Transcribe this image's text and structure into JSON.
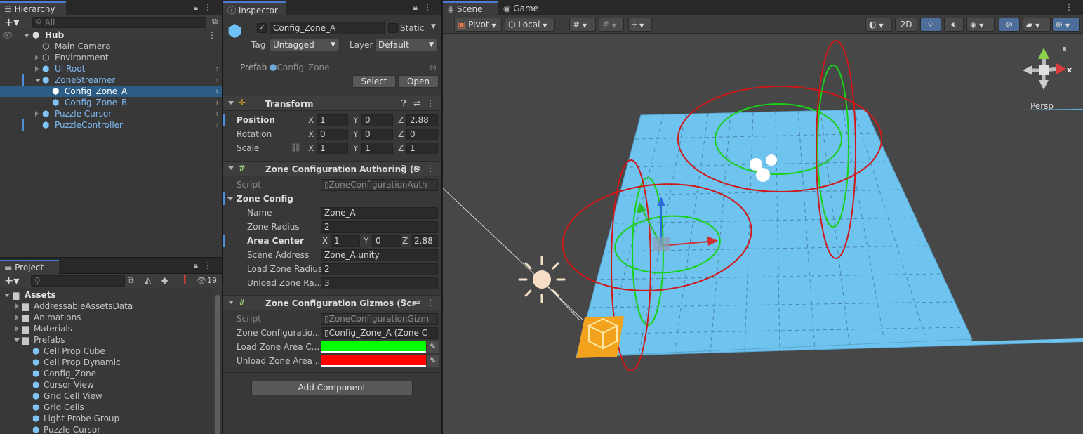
{
  "hierarchy": {
    "tab": "Hierarchy",
    "search_placeholder": "All",
    "root": "Hub",
    "items": [
      {
        "label": "Main Camera"
      },
      {
        "label": "Environment"
      },
      {
        "label": "UI Root"
      },
      {
        "label": "ZoneStreamer"
      },
      {
        "label": "Config_Zone_A"
      },
      {
        "label": "Config_Zone_B"
      },
      {
        "label": "Puzzle Cursor"
      },
      {
        "label": "PuzzleController"
      }
    ]
  },
  "project": {
    "tab": "Project",
    "hidden_count": "19",
    "root": "Assets",
    "folders": [
      "AddressableAssetsData",
      "Animations",
      "Materials",
      "Prefabs"
    ],
    "prefabs": [
      "Cell Prop Cube",
      "Cell Prop Dynamic",
      "Config_Zone",
      "Cursor View",
      "Grid Cell View",
      "Grid Cells",
      "Light Probe Group",
      "Puzzle Cursor"
    ]
  },
  "inspector": {
    "tab": "Inspector",
    "object_name": "Config_Zone_A",
    "static_label": "Static",
    "tag_label": "Tag",
    "tag_value": "Untagged",
    "layer_label": "Layer",
    "layer_value": "Default",
    "prefab_label": "Prefab",
    "prefab_value": "Config_Zone",
    "select_button": "Select",
    "open_button": "Open",
    "transform": {
      "title": "Transform",
      "position_label": "Position",
      "rotation_label": "Rotation",
      "scale_label": "Scale",
      "position": {
        "x": "1",
        "y": "0",
        "z": "2.88"
      },
      "rotation": {
        "x": "0",
        "y": "0",
        "z": "0"
      },
      "scale": {
        "x": "1",
        "y": "1",
        "z": "1"
      }
    },
    "authoring": {
      "title": "Zone Configuration Authoring (S",
      "script_label": "Script",
      "script_value": "ZoneConfigurationAuth",
      "group_label": "Zone Config",
      "name_label": "Name",
      "name_value": "Zone_A",
      "radius_label": "Zone Radius",
      "radius_value": "2",
      "center_label": "Area Center",
      "center": {
        "x": "1",
        "y": "0",
        "z": "2.88"
      },
      "address_label": "Scene Address",
      "address_value": "Zone_A.unity",
      "load_label": "Load Zone Radius",
      "load_value": "2",
      "unload_label": "Unload Zone Ra...",
      "unload_value": "3"
    },
    "gizmos": {
      "title": "Zone Configuration Gizmos (Scr",
      "script_label": "Script",
      "script_value": "ZoneConfigurationGizm",
      "config_label": "Zone Configuratio...",
      "config_value": "Config_Zone_A (Zone C",
      "load_color_label": "Load Zone Area C...",
      "unload_color_label": "Unload Zone Area ...",
      "load_color": "#00ff00",
      "unload_color": "#ff0000"
    },
    "add_component": "Add Component",
    "axis": {
      "x": "X",
      "y": "Y",
      "z": "Z"
    }
  },
  "scene": {
    "tab_scene": "Scene",
    "tab_game": "Game",
    "pivot": "Pivot",
    "local": "Local",
    "mode_2d": "2D",
    "persp": "Persp",
    "gizmo_x": "x",
    "plane_color": "#6ec3ef"
  }
}
